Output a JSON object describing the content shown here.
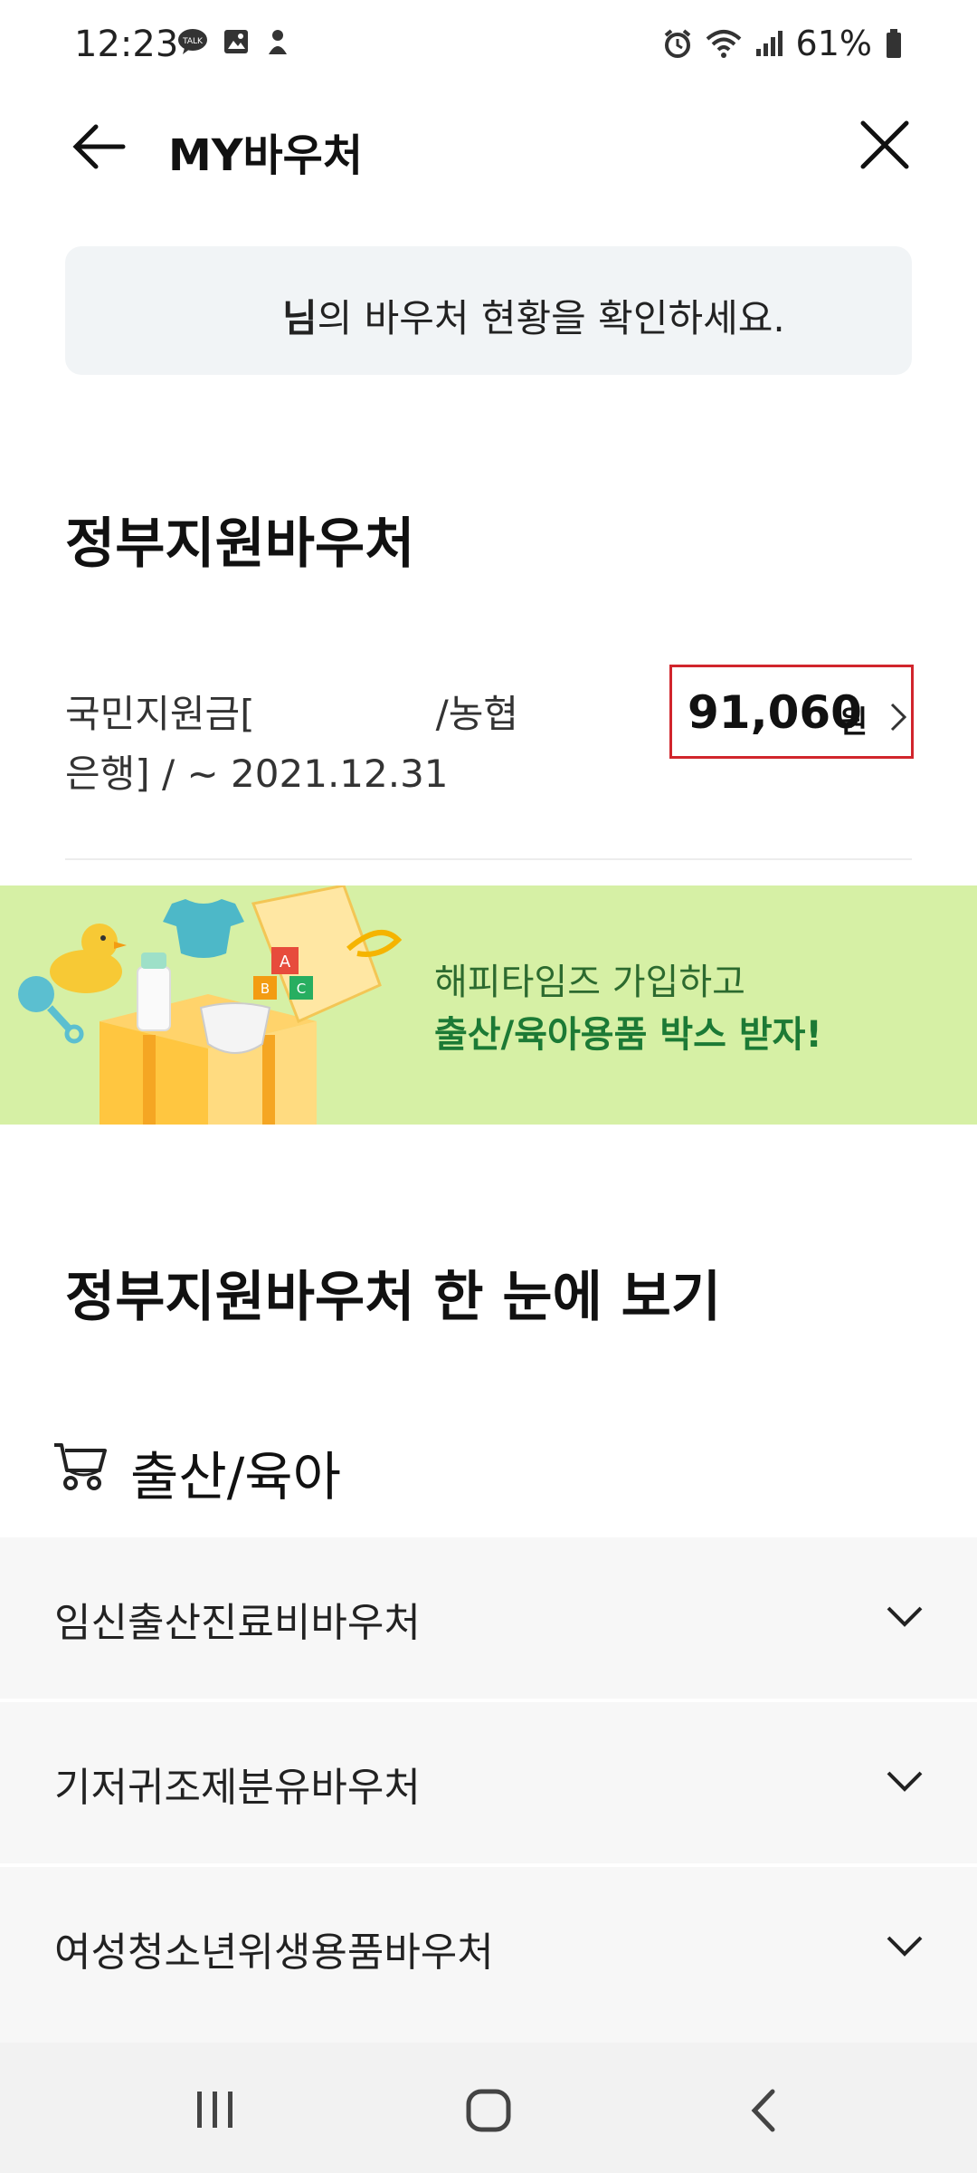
{
  "status_bar": {
    "time": "12:23",
    "battery": "61%",
    "left_icons": [
      "talk-icon",
      "gallery-icon",
      "notification-icon"
    ],
    "right_icons": [
      "alarm-icon",
      "wifi-icon",
      "signal-icon",
      "battery-icon"
    ]
  },
  "header": {
    "title": "MY바우처"
  },
  "greeting": {
    "name": "님",
    "message": "의 바우처 현황을 확인하세요."
  },
  "government_vouchers": {
    "title": "정부지원바우처",
    "item": {
      "name_part1": "국민지원금[",
      "name_part2": "/농협",
      "name_part3": "은행] / ~ 2021.12.31",
      "amount": "91,060",
      "unit": "원"
    }
  },
  "banner": {
    "line1": "해피타임즈 가입하고",
    "line2": "출산/육아용품 박스 받자!"
  },
  "overview": {
    "title": "정부지원바우처 한 눈에 보기",
    "category": "출산/육아",
    "items": [
      {
        "label": "임신출산진료비바우처"
      },
      {
        "label": "기저귀조제분유바우처"
      },
      {
        "label": "여성청소년위생용품바우처"
      }
    ]
  },
  "colors": {
    "highlight_border": "#d1252c",
    "banner_bg": "#d6f0a5",
    "banner_text": "#1c7a35"
  }
}
